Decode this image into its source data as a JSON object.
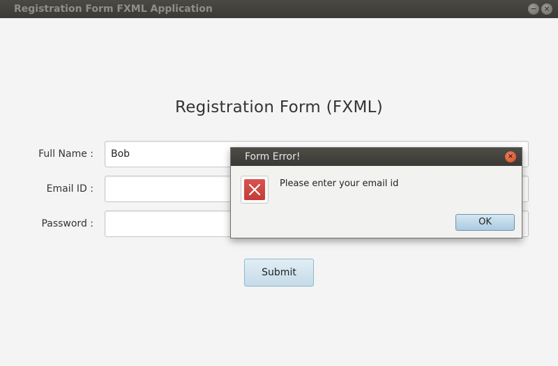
{
  "window": {
    "title": "Registration Form FXML Application",
    "minimize_symbol": "−",
    "close_symbol": "×"
  },
  "form": {
    "title": "Registration Form (FXML)",
    "fields": [
      {
        "label": "Full Name :",
        "value": "Bob"
      },
      {
        "label": "Email ID :",
        "value": ""
      },
      {
        "label": "Password :",
        "value": ""
      }
    ],
    "submit_label": "Submit"
  },
  "dialog": {
    "title": "Form Error!",
    "close_symbol": "×",
    "icon": "error-x-icon",
    "message": "Please enter your email id",
    "ok_label": "OK"
  },
  "colors": {
    "titlebar": "#3b3a36",
    "background": "#f4f4f4",
    "error_red": "#d9534f",
    "close_orange": "#e05a2f",
    "button_blue": "#c4dbe8"
  }
}
